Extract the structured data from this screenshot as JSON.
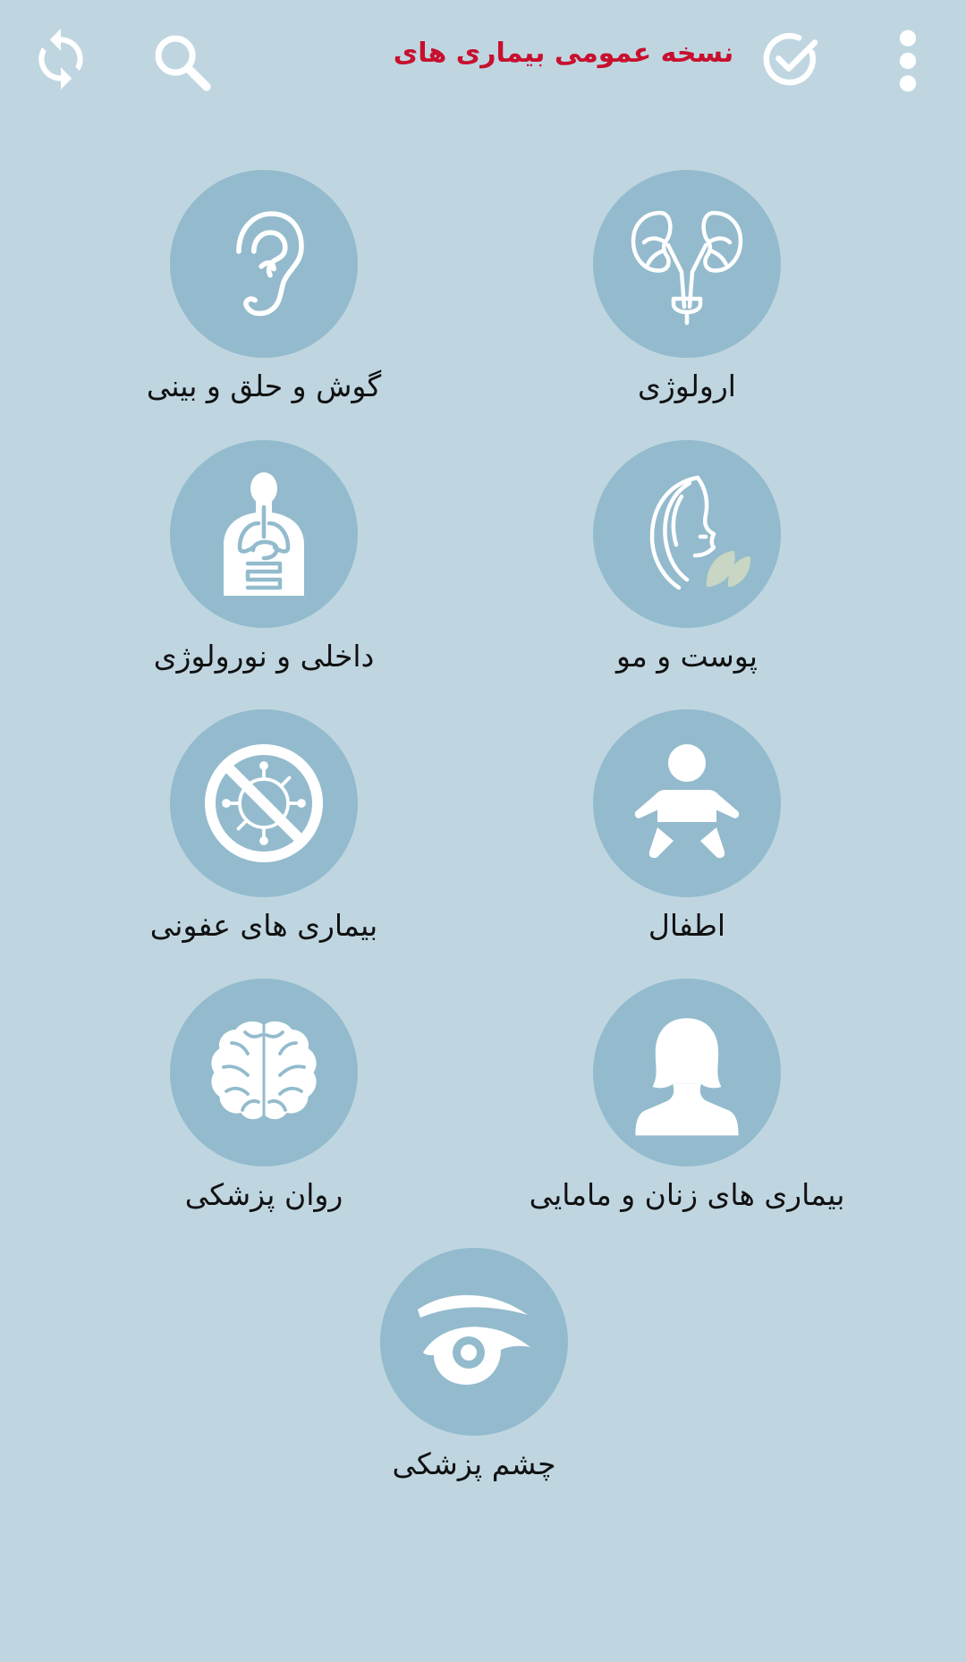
{
  "header": {
    "title": "نسخه  عمومی بیماری های",
    "icons": {
      "menu": "more-vert-icon",
      "done": "check-circle-icon",
      "search": "search-icon",
      "refresh": "sync-icon"
    }
  },
  "categories": [
    {
      "label": "ارولوژی",
      "icon": "kidney-icon"
    },
    {
      "label": "گوش و حلق و بینی",
      "icon": "ear-icon"
    },
    {
      "label": "پوست و مو",
      "icon": "skin-hair-icon"
    },
    {
      "label": "داخلی و نورولوژی",
      "icon": "internal-organs-icon"
    },
    {
      "label": "اطفال",
      "icon": "baby-icon"
    },
    {
      "label": "بیماری های عفونی",
      "icon": "no-virus-icon"
    },
    {
      "label": "بیماری های زنان و مامایی",
      "icon": "woman-icon"
    },
    {
      "label": "روان پزشکی",
      "icon": "brain-icon"
    },
    {
      "label": "چشم پزشکی",
      "icon": "eye-icon"
    }
  ],
  "colors": {
    "background": "#bfd6e1",
    "circle": "#93bbcd",
    "title": "#c8102e",
    "icon": "#ffffff"
  }
}
